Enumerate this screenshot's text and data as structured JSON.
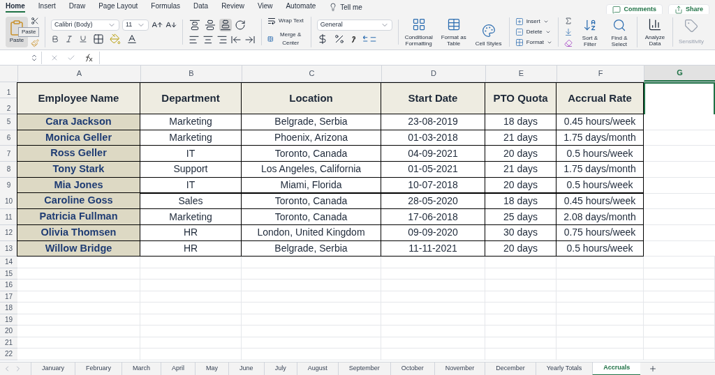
{
  "menu_tabs": [
    {
      "label": "Home",
      "selected": true
    },
    {
      "label": "Insert",
      "selected": false
    },
    {
      "label": "Draw",
      "selected": false
    },
    {
      "label": "Page Layout",
      "selected": false
    },
    {
      "label": "Formulas",
      "selected": false
    },
    {
      "label": "Data",
      "selected": false
    },
    {
      "label": "Review",
      "selected": false
    },
    {
      "label": "View",
      "selected": false
    },
    {
      "label": "Automate",
      "selected": false
    }
  ],
  "tell_me": "Tell me",
  "comments_button": "Comments",
  "share_button": "Share",
  "ribbon": {
    "paste_label": "Paste",
    "paste_tooltip": "Paste",
    "font_name": "Calibri (Body)",
    "font_size": "11",
    "vertical_align": [
      {
        "kind": "top",
        "selected": false
      },
      {
        "kind": "middle",
        "selected": false
      },
      {
        "kind": "bottom",
        "selected": true
      }
    ],
    "wrap_text": "Wrap Text",
    "merge_center": "Merge & Center",
    "number_format": "General",
    "styles": [
      "Conditional Formatting",
      "Format as Table",
      "Cell Styles"
    ],
    "cells": [
      "Insert",
      "Delete",
      "Format"
    ],
    "editing": [
      "Sort & Filter",
      "Find & Select"
    ],
    "analyze_data": "Analyze Data",
    "sensitivity": {
      "label": "Sensitivity",
      "disabled": true
    }
  },
  "columns": [
    {
      "letter": "A",
      "selected": false
    },
    {
      "letter": "B",
      "selected": false
    },
    {
      "letter": "C",
      "selected": false
    },
    {
      "letter": "D",
      "selected": false
    },
    {
      "letter": "E",
      "selected": false
    },
    {
      "letter": "F",
      "selected": false
    },
    {
      "letter": "G",
      "selected": true
    }
  ],
  "header_row_numbers": [
    "1",
    "2"
  ],
  "table_headers": [
    "Employee Name",
    "Department",
    "Location",
    "Start Date",
    "PTO Quota",
    "Accrual Rate"
  ],
  "rows": [
    {
      "row_number": "5",
      "cells": [
        "Cara Jackson",
        "Marketing",
        "Belgrade, Serbia",
        "23-08-2019",
        "18 days",
        "0.45 hours/week"
      ]
    },
    {
      "row_number": "6",
      "cells": [
        "Monica Geller",
        "Marketing",
        "Phoenix, Arizona",
        "01-03-2018",
        "21 days",
        "1.75 days/month"
      ]
    },
    {
      "row_number": "7",
      "cells": [
        "Ross Geller",
        "IT",
        "Toronto, Canada",
        "04-09-2021",
        "20 days",
        "0.5 hours/week"
      ]
    },
    {
      "row_number": "8",
      "cells": [
        "Tony Stark",
        "Support",
        "Los Angeles, California",
        "01-05-2021",
        "21 days",
        "1.75 days/month"
      ]
    },
    {
      "row_number": "9",
      "cells": [
        "Mia Jones",
        "IT",
        "Miami, Florida",
        "10-07-2018",
        "20 days",
        "0.5 hours/week"
      ]
    },
    {
      "row_number": "10",
      "cells": [
        "Caroline Goss",
        "Sales",
        "Toronto, Canada",
        "28-05-2020",
        "18 days",
        "0.45 hours/week"
      ]
    },
    {
      "row_number": "11",
      "cells": [
        "Patricia Fullman",
        "Marketing",
        "Toronto, Canada",
        "17-06-2018",
        "25 days",
        "2.08 days/month"
      ]
    },
    {
      "row_number": "12",
      "cells": [
        "Olivia Thomsen",
        "HR",
        "London, United Kingdom",
        "09-09-2020",
        "30 days",
        "0.75 hours/week"
      ]
    },
    {
      "row_number": "13",
      "cells": [
        "Willow Bridge",
        "HR",
        "Belgrade, Serbia",
        "11-11-2021",
        "20 days",
        "0.5 hours/week"
      ]
    }
  ],
  "empty_rows": [
    "14",
    "15",
    "16",
    "17",
    "18",
    "19",
    "20",
    "21",
    "22"
  ],
  "sheet_tabs": [
    {
      "label": "January",
      "selected": false
    },
    {
      "label": "February",
      "selected": false
    },
    {
      "label": "March",
      "selected": false
    },
    {
      "label": "April",
      "selected": false
    },
    {
      "label": "May",
      "selected": false
    },
    {
      "label": "June",
      "selected": false
    },
    {
      "label": "July",
      "selected": false
    },
    {
      "label": "August",
      "selected": false
    },
    {
      "label": "September",
      "selected": false
    },
    {
      "label": "October",
      "selected": false
    },
    {
      "label": "November",
      "selected": false
    },
    {
      "label": "December",
      "selected": false
    },
    {
      "label": "Yearly Totals",
      "selected": false
    },
    {
      "label": "Accruals",
      "selected": true
    }
  ]
}
